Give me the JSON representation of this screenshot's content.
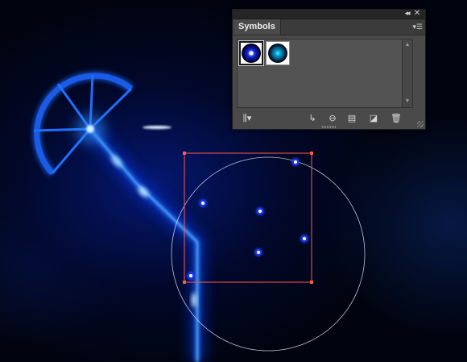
{
  "canvas": {
    "background_color": "#01040f",
    "glow_color": "#1a6dff",
    "selection_color": "#ff5a4a",
    "guide_circle_color": "#cfd8e8"
  },
  "symbols_panel": {
    "tab_label": "Symbols",
    "collapse_icon": "double-chevron-left-icon",
    "close_icon": "close-icon",
    "menu_icon": "panel-menu-icon",
    "symbols": [
      {
        "name": "blue-glow-orb-symbol",
        "color": "#1020d8",
        "selected": true
      },
      {
        "name": "cyan-glow-orb-symbol",
        "color": "#0aa6d0",
        "selected": false
      }
    ],
    "toolbar": [
      {
        "icon": "symbol-libraries-menu-icon"
      },
      {
        "icon": "place-symbol-instance-icon"
      },
      {
        "icon": "break-link-to-symbol-icon"
      },
      {
        "icon": "symbol-options-icon"
      },
      {
        "icon": "new-symbol-icon"
      },
      {
        "icon": "delete-symbol-icon"
      }
    ]
  }
}
